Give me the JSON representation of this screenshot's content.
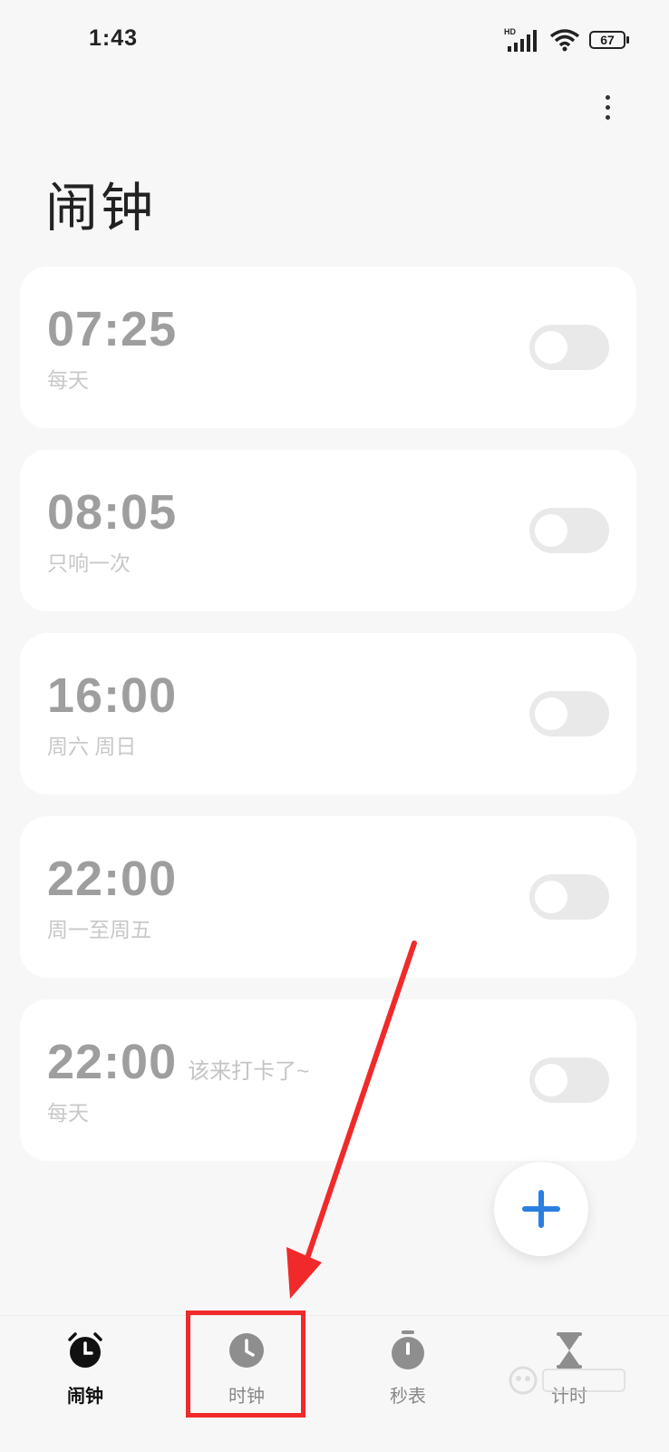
{
  "status_bar": {
    "time": "1:43",
    "network_label": "HD",
    "battery": "67"
  },
  "header": {
    "title": "闹钟",
    "more_icon": "more-vertical-icon"
  },
  "alarms": [
    {
      "time": "07:25",
      "note": "",
      "repeat": "每天",
      "enabled": false
    },
    {
      "time": "08:05",
      "note": "",
      "repeat": "只响一次",
      "enabled": false
    },
    {
      "time": "16:00",
      "note": "",
      "repeat": "周六 周日",
      "enabled": false
    },
    {
      "time": "22:00",
      "note": "",
      "repeat": "周一至周五",
      "enabled": false
    },
    {
      "time": "22:00",
      "note": "该来打卡了~",
      "repeat": "每天",
      "enabled": false
    }
  ],
  "fab": {
    "icon": "plus-icon",
    "color": "#2b7fe0"
  },
  "bottom_nav": {
    "items": [
      {
        "label": "闹钟",
        "icon": "alarm-clock-icon",
        "active": true
      },
      {
        "label": "时钟",
        "icon": "clock-icon",
        "active": false
      },
      {
        "label": "秒表",
        "icon": "stopwatch-icon",
        "active": false
      },
      {
        "label": "计时",
        "icon": "hourglass-icon",
        "active": false
      }
    ]
  },
  "annotation": {
    "color": "#f02a2a"
  }
}
